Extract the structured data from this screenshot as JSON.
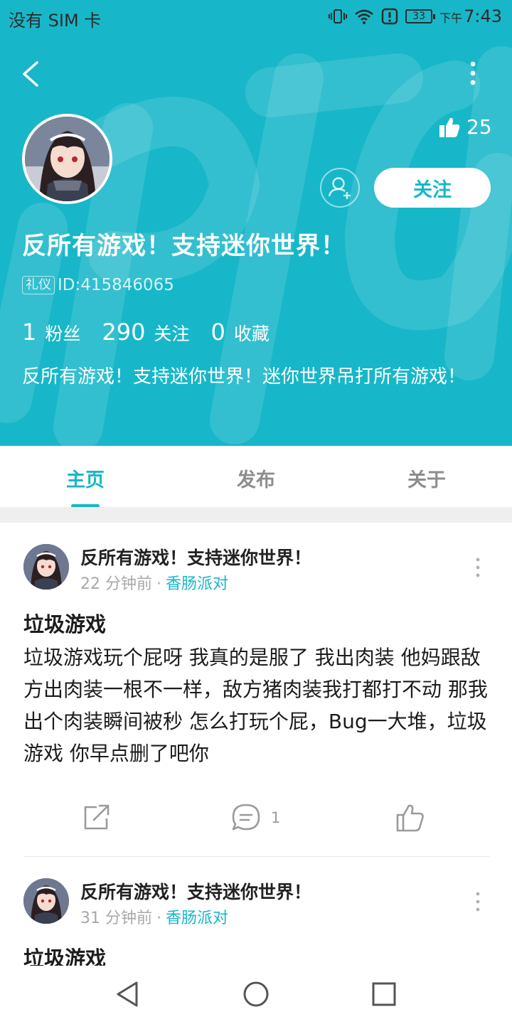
{
  "status_bar": {
    "carrier": "没有 SIM 卡",
    "battery": "33",
    "time_prefix": "下午",
    "time": "7:43"
  },
  "profile": {
    "likes": "25",
    "follow_label": "关注",
    "name": "反所有游戏！支持迷你世界！",
    "badge": "礼仪",
    "id_text": "ID:415846065",
    "stats": [
      {
        "num": "1",
        "label": "粉丝"
      },
      {
        "num": "290",
        "label": "关注"
      },
      {
        "num": "0",
        "label": "收藏"
      }
    ],
    "bio": "反所有游戏！支持迷你世界！迷你世界吊打所有游戏！"
  },
  "tabs": [
    {
      "label": "主页",
      "active": true
    },
    {
      "label": "发布",
      "active": false
    },
    {
      "label": "关于",
      "active": false
    }
  ],
  "posts": [
    {
      "author": "反所有游戏！支持迷你世界！",
      "time": "22 分钟前",
      "separator": "·",
      "group": "香肠派对",
      "title": "垃圾游戏",
      "body": "垃圾游戏玩个屁呀 我真的是服了 我出肉装 他妈跟敌方出肉装一根不一样，敌方猪肉装我打都打不动 那我出个肉装瞬间被秒 怎么打玩个屁，Bug一大堆，垃圾游戏 你早点删了吧你",
      "comments": "1"
    },
    {
      "author": "反所有游戏！支持迷你世界！",
      "time": "31 分钟前",
      "separator": "·",
      "group": "香肠派对",
      "title": "垃圾游戏"
    }
  ],
  "colors": {
    "accent": "#17b7c9",
    "text": "#1c1c1c",
    "muted": "#a8a8a8"
  },
  "icons": [
    "back-arrow-icon",
    "more-vertical-icon",
    "thumbs-up-icon",
    "add-friend-icon",
    "share-icon",
    "comment-icon",
    "like-icon",
    "nav-back-icon",
    "nav-home-icon",
    "nav-recents-icon"
  ]
}
